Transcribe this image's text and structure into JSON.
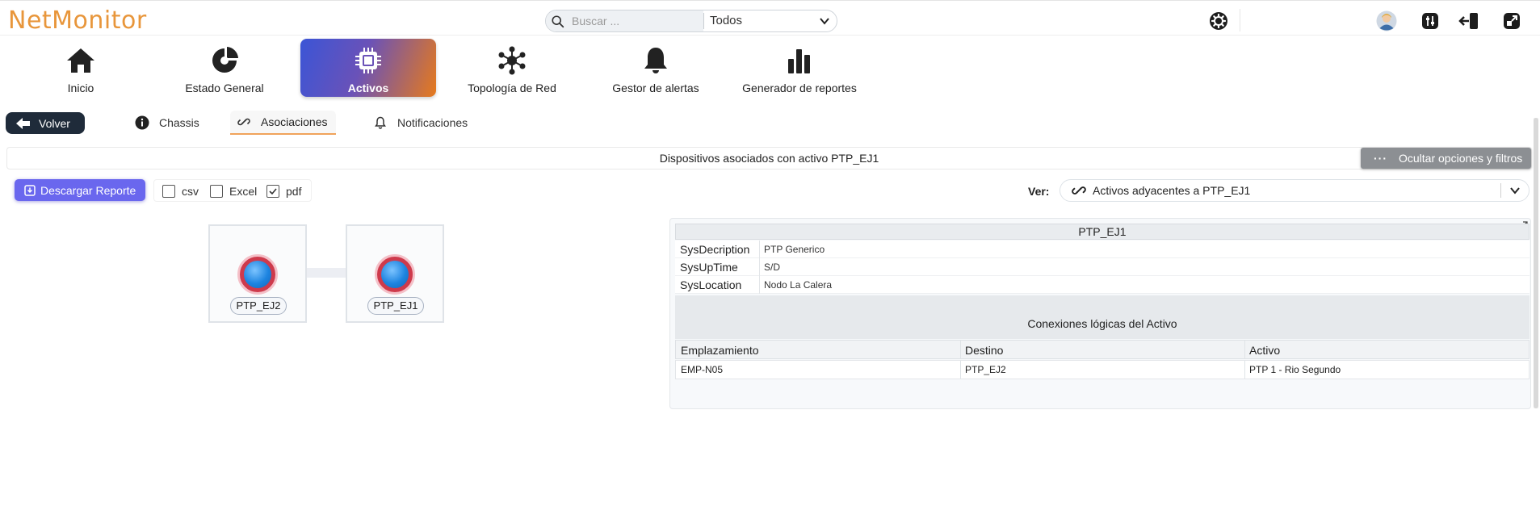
{
  "app": {
    "logo": "NetMonitor"
  },
  "search": {
    "placeholder": "Buscar ...",
    "scope": "Todos"
  },
  "nav": {
    "items": [
      {
        "label": "Inicio",
        "icon": "home-icon"
      },
      {
        "label": "Estado General",
        "icon": "gauge-icon"
      },
      {
        "label": "Activos",
        "icon": "chip-icon",
        "active": true
      },
      {
        "label": "Topología de Red",
        "icon": "network-icon"
      },
      {
        "label": "Gestor de alertas",
        "icon": "bell-icon"
      },
      {
        "label": "Generador de reportes",
        "icon": "bar-chart-icon"
      }
    ]
  },
  "subnav": {
    "back_label": "Volver",
    "tabs": [
      {
        "label": "Chassis",
        "icon": "info-icon"
      },
      {
        "label": "Asociaciones",
        "icon": "link-icon",
        "active": true
      },
      {
        "label": "Notificaciones",
        "icon": "bell-icon"
      }
    ]
  },
  "section": {
    "title": "Dispositivos asociados con activo PTP_EJ1",
    "toggle_label": "Ocultar opciones y filtros"
  },
  "toolbar": {
    "download_label": "Descargar Reporte",
    "formats": [
      {
        "label": "csv",
        "checked": false
      },
      {
        "label": "Excel",
        "checked": false
      },
      {
        "label": "pdf",
        "checked": true
      }
    ],
    "view_label": "Ver:",
    "view_value": "Activos adyacentes a PTP_EJ1"
  },
  "graph": {
    "nodes": [
      {
        "label": "PTP_EJ2"
      },
      {
        "label": "PTP_EJ1"
      }
    ]
  },
  "details": {
    "title": "PTP_EJ1",
    "fields": [
      {
        "key": "SysDecription",
        "value": "PTP Generico"
      },
      {
        "key": "SysUpTime",
        "value": "S/D"
      },
      {
        "key": "SysLocation",
        "value": "Nodo La Calera"
      }
    ],
    "connections_title": "Conexiones lógicas del Activo",
    "columns": [
      "Emplazamiento",
      "Destino",
      "Activo"
    ],
    "rows": [
      [
        "EMP-N05",
        "PTP_EJ2",
        "PTP 1 - Rio Segundo"
      ]
    ]
  },
  "colors": {
    "logo": "#e8963b",
    "active_gradient_start": "#3b55d6",
    "active_gradient_end": "#e67a1c",
    "download_button": "#6a67ee",
    "back_button": "#1f2b3a",
    "node_ring": "#ce3a4c",
    "node_core": "#1d84e0"
  }
}
